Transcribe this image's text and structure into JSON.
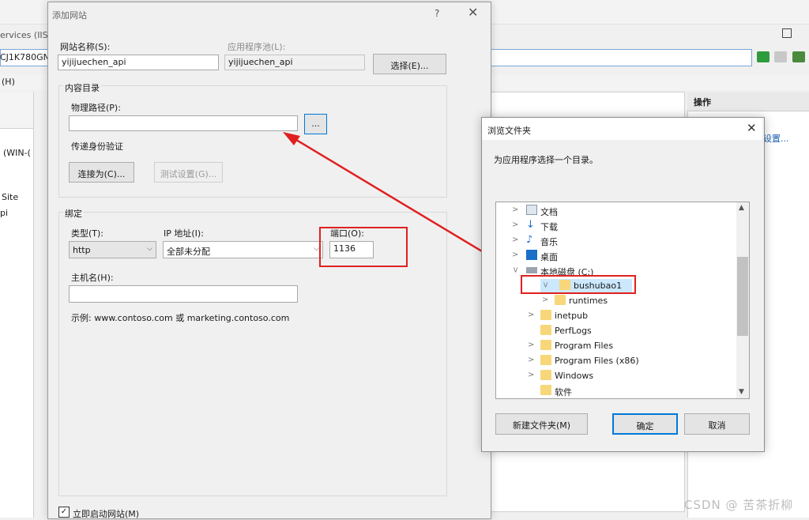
{
  "background_window": {
    "title_fragment": "ervices (IIS",
    "address_fragment": "CJ1K780GN",
    "menu_fragment": "(H)",
    "left_items": [
      "(WIN-(",
      "Site",
      "pi"
    ],
    "right_header": "操作",
    "right_link": "设置..."
  },
  "add_site_dialog": {
    "title": "添加网站",
    "help": "?",
    "close": "✕",
    "site_name_label": "网站名称(S):",
    "site_name_value": "yijijuechen_api",
    "app_pool_label": "应用程序池(L):",
    "app_pool_value": "yijijuechen_api",
    "select_button": "选择(E)...",
    "content_dir_group": "内容目录",
    "physical_path_label": "物理路径(P):",
    "physical_path_value": "",
    "browse_button": "...",
    "pass_auth_label": "传递身份验证",
    "connect_as_button": "连接为(C)...",
    "test_settings_button": "测试设置(G)...",
    "binding_group": "绑定",
    "type_label": "类型(T):",
    "type_value": "http",
    "ip_label": "IP 地址(I):",
    "ip_value": "全部未分配",
    "port_label": "端口(O):",
    "port_value": "1136",
    "hostname_label": "主机名(H):",
    "hostname_value": "",
    "example_text": "示例: www.contoso.com 或 marketing.contoso.com",
    "start_immediately_label": "立即启动网站(M)",
    "start_immediately_checked": true
  },
  "browse_dialog": {
    "title": "浏览文件夹",
    "close": "✕",
    "prompt": "为应用程序选择一个目录。",
    "tree": [
      {
        "label": "文档",
        "icon": "documents-icon"
      },
      {
        "label": "下载",
        "icon": "downloads-icon"
      },
      {
        "label": "音乐",
        "icon": "music-icon"
      },
      {
        "label": "桌面",
        "icon": "desktop-icon"
      },
      {
        "label": "本地磁盘 (C:)",
        "icon": "drive-icon"
      },
      {
        "label": "bushubao1",
        "icon": "folder-icon",
        "selected": true
      },
      {
        "label": "runtimes",
        "icon": "folder-icon"
      },
      {
        "label": "inetpub",
        "icon": "folder-icon"
      },
      {
        "label": "PerfLogs",
        "icon": "folder-icon"
      },
      {
        "label": "Program Files",
        "icon": "folder-icon"
      },
      {
        "label": "Program Files (x86)",
        "icon": "folder-icon"
      },
      {
        "label": "Windows",
        "icon": "folder-icon"
      },
      {
        "label": "软件",
        "icon": "folder-icon"
      }
    ],
    "new_folder_button": "新建文件夹(M)",
    "ok_button": "确定",
    "cancel_button": "取消"
  },
  "watermark": "CSDN @ 苦茶折柳",
  "colors": {
    "annotation_red": "#e02020",
    "selection_blue": "#cce8ff",
    "focus_blue": "#0078d7"
  }
}
